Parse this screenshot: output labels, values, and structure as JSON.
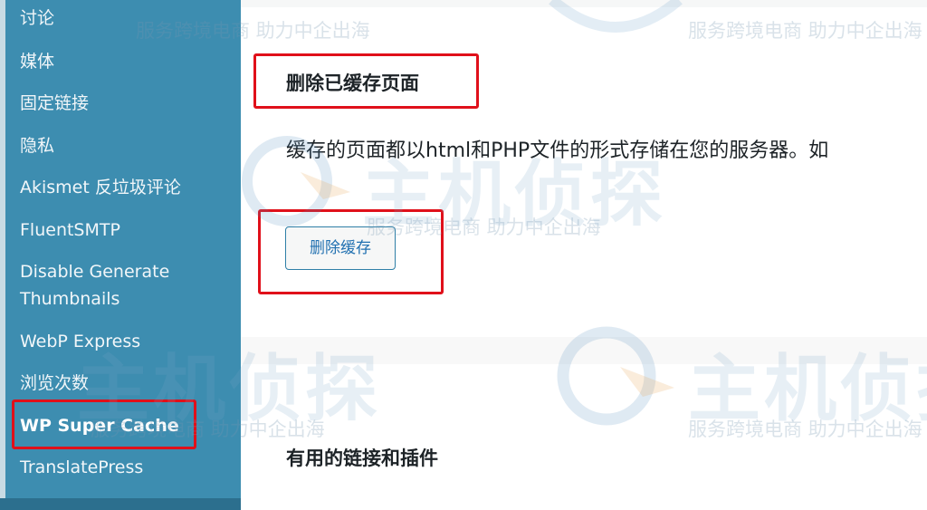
{
  "sidebar": {
    "items": [
      {
        "label": "讨论",
        "active": false
      },
      {
        "label": "媒体",
        "active": false
      },
      {
        "label": "固定链接",
        "active": false
      },
      {
        "label": "隐私",
        "active": false
      },
      {
        "label": "Akismet 反垃圾评论",
        "active": false
      },
      {
        "label": "FluentSMTP",
        "active": false
      },
      {
        "label": "Disable Generate",
        "active": false
      },
      {
        "label": "Thumbnails",
        "active": false
      },
      {
        "label": "WebP Express",
        "active": false
      },
      {
        "label": "浏览次数",
        "active": false
      },
      {
        "label": "WP Super Cache",
        "active": true
      },
      {
        "label": "TranslatePress",
        "active": false
      }
    ]
  },
  "main": {
    "delete_section": {
      "title": "删除已缓存页面",
      "description": "缓存的页面都以html和PHP文件的形式存储在您的服务器。如",
      "button_label": "删除缓存"
    },
    "links_section": {
      "title": "有用的链接和插件"
    }
  },
  "watermark": {
    "text": "服务跨境电商 助力中企出海",
    "brand": "主机侦探"
  },
  "colors": {
    "sidebar_bg": "#3d8db0",
    "highlight_box": "#e0101a",
    "button_text": "#2271b1"
  }
}
